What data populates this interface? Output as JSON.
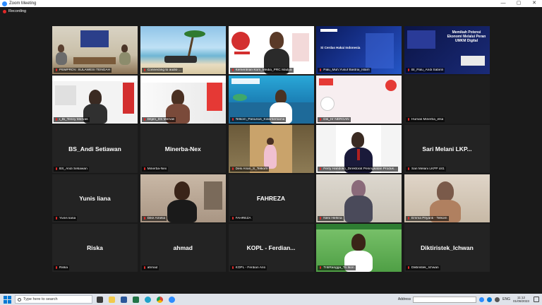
{
  "window": {
    "title": "Zoom Meeting",
    "controls": [
      "—",
      "▢",
      "✕"
    ]
  },
  "recording": {
    "label": "Recording"
  },
  "tiles": [
    {
      "name": "PEMPROV. SULAWESI TENGAH",
      "video": "v-room",
      "active": true
    },
    {
      "name": "Connecting to audio ...",
      "video": "v-beach"
    },
    {
      "name": "Kementrian Kom_Media_PRC Madya",
      "video": "v-red"
    },
    {
      "name": "Palu_Muh.Yusuf Bastrai_Islam",
      "video": "v-blue"
    },
    {
      "name": "BI_Palu_Andi Sabirin",
      "video": "v-navy"
    },
    {
      "name": "i_Bi_Tenny Mervas",
      "video": "v-bi"
    },
    {
      "name": "Ditjen_DS Mervas",
      "video": "v-indo"
    },
    {
      "name": "Telkom_PasLikus_Kolarbersama",
      "video": "v-sea"
    },
    {
      "name": "Dik_Hr NERGAN",
      "video": "v-pink"
    },
    {
      "name": "Humas Minerba_elsa",
      "video": "v-dark"
    },
    {
      "name": "BS_Andi Setiawan",
      "center": "BS_Andi Setiawan"
    },
    {
      "name": "Minerba-Nex",
      "center": "Minerba-Nex"
    },
    {
      "name": "Desi Arian_S_Telkom",
      "video": "v-art"
    },
    {
      "name": "Ferry Handoko_Direktorat Peningkatan Produk...",
      "video": "v-white"
    },
    {
      "name": "Sari Melani LKPP d41",
      "center": "Sari Melani LKP..."
    },
    {
      "name": "Yunis liana",
      "center": "Yunis liana"
    },
    {
      "name": "Dike Amelia",
      "video": "v-girl"
    },
    {
      "name": "FAHREZA",
      "center": "FAHREZA"
    },
    {
      "name": "Neni Herlina",
      "video": "v-hijab"
    },
    {
      "name": "Emma Priyanti - Telkom",
      "video": "v-hijab2"
    },
    {
      "name": "Riska",
      "center": "Riska"
    },
    {
      "name": "ahmad",
      "center": "ahmad"
    },
    {
      "name": "KOPL - Ferdian Ario",
      "center": "KOPL - Ferdian..."
    },
    {
      "name": "TribRangga_Tri Ikon",
      "video": "v-green"
    },
    {
      "name": "Diktiristek_Ichwan",
      "center": "Diktiristek_Ichwan"
    }
  ],
  "taskbar": {
    "search_placeholder": "Type here to search",
    "address_label": "Address",
    "language": "ENG",
    "time": "11:12",
    "date": "01/08/2023"
  },
  "colors": {
    "active_speaker": "#f5e64a",
    "recording": "#e02828",
    "accent": "#2d8cff"
  }
}
